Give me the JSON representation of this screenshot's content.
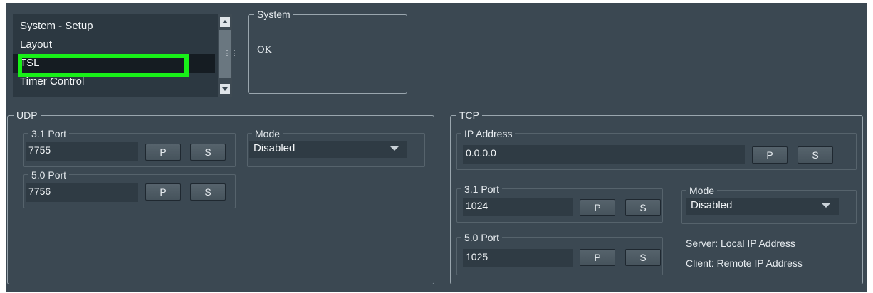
{
  "nav_list": {
    "items": [
      {
        "label": "System - Setup"
      },
      {
        "label": "Layout"
      },
      {
        "label": "TSL"
      },
      {
        "label": "Timer Control"
      }
    ],
    "selected_index": 2
  },
  "system": {
    "legend": "System",
    "status": "OK"
  },
  "udp": {
    "legend": "UDP",
    "port31": {
      "legend": "3.1 Port",
      "value": "7755",
      "p_label": "P",
      "s_label": "S"
    },
    "port50": {
      "legend": "5.0 Port",
      "value": "7756",
      "p_label": "P",
      "s_label": "S"
    },
    "mode": {
      "legend": "Mode",
      "value": "Disabled"
    }
  },
  "tcp": {
    "legend": "TCP",
    "ip": {
      "legend": "IP Address",
      "value": "0.0.0.0",
      "p_label": "P",
      "s_label": "S"
    },
    "port31": {
      "legend": "3.1 Port",
      "value": "1024",
      "p_label": "P",
      "s_label": "S"
    },
    "port50": {
      "legend": "5.0 Port",
      "value": "1025",
      "p_label": "P",
      "s_label": "S"
    },
    "mode": {
      "legend": "Mode",
      "value": "Disabled"
    },
    "note_server": "Server: Local IP Address",
    "note_client": "Client: Remote IP Address"
  },
  "colors": {
    "panel_bg": "#3b4852",
    "highlight": "#18f018"
  },
  "icons": [
    "scroll-up-icon",
    "scroll-down-icon",
    "scroll-grip-icon",
    "dropdown-caret-icon"
  ]
}
